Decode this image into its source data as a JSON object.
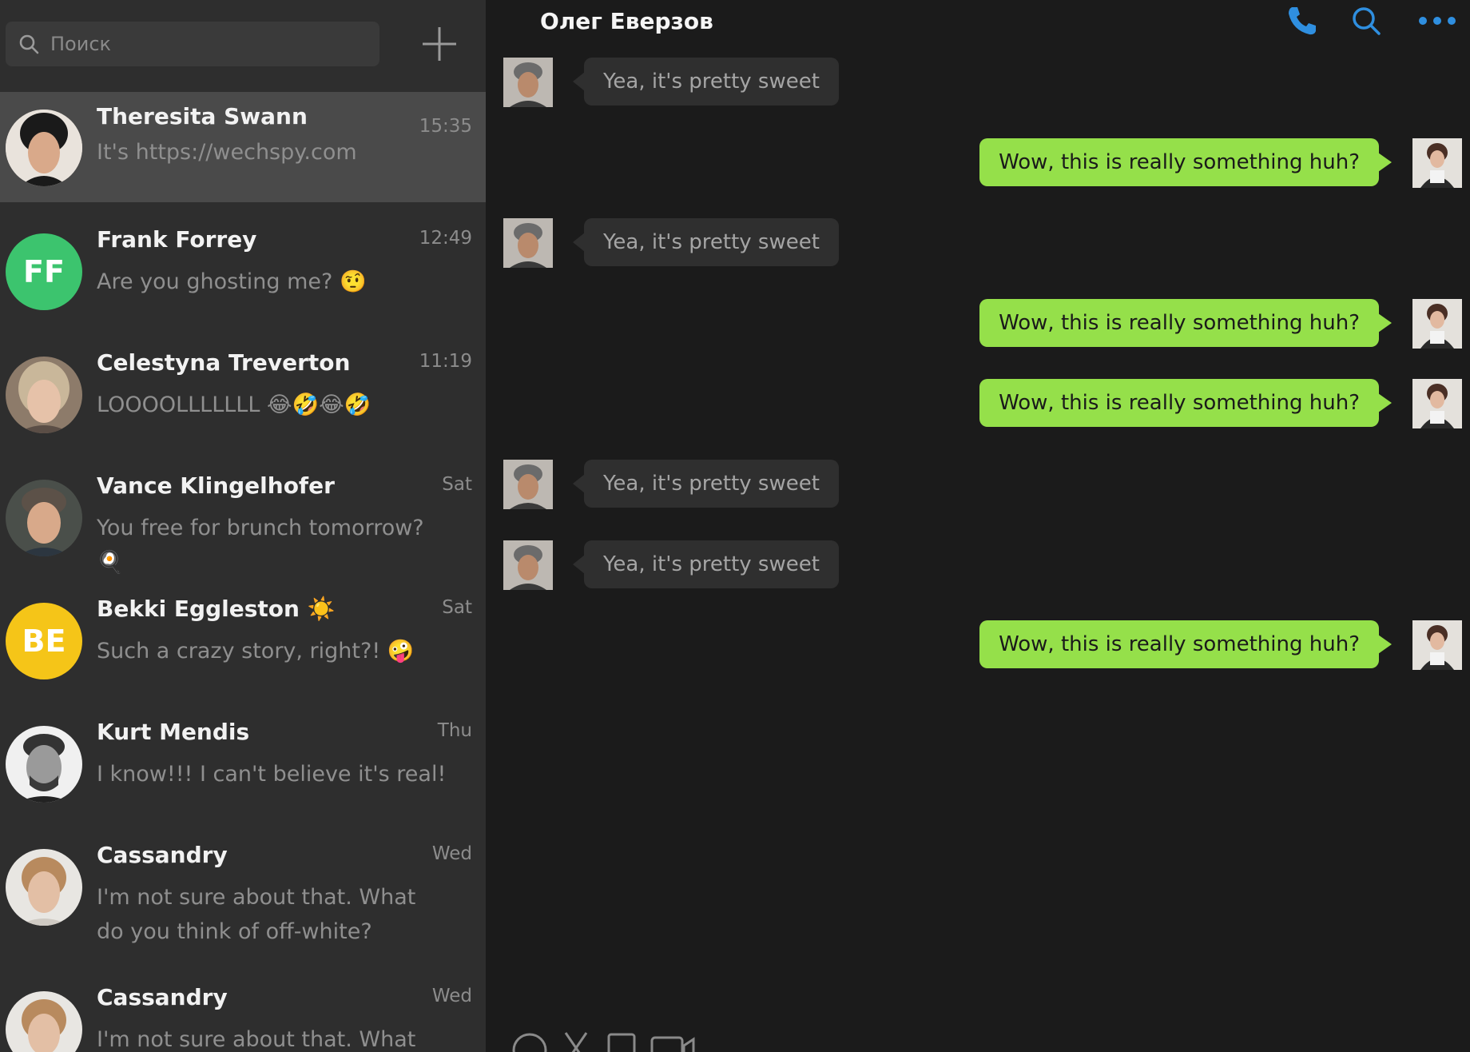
{
  "search": {
    "placeholder": "Поиск"
  },
  "sidebar": {
    "chats": [
      {
        "name": "Theresita Swann",
        "time": "15:35",
        "preview": "It's https://wechspy.com",
        "avatar": "photo"
      },
      {
        "name": "Frank Forrey",
        "time": "12:49",
        "preview": "Are you ghosting me? 🤨",
        "avatar": "initials",
        "initials": "FF",
        "avatar_color": "#3cc46e"
      },
      {
        "name": "Celestyna Treverton",
        "time": "11:19",
        "preview": "LOOOOLLLLLLL 😂🤣😂🤣",
        "avatar": "photo"
      },
      {
        "name": "Vance Klingelhofer",
        "time": "Sat",
        "preview": "You free for brunch tomorrow? 🍳",
        "avatar": "photo"
      },
      {
        "name": "Bekki Eggleston ☀️",
        "time": "Sat",
        "preview": "Such a crazy story, right?! 🤪",
        "avatar": "initials",
        "initials": "BE",
        "avatar_color": "#f5c518"
      },
      {
        "name": "Kurt Mendis",
        "time": "Thu",
        "preview": "I know!!! I can't believe it's real!",
        "avatar": "photo"
      },
      {
        "name": "Cassandry",
        "time": "Wed",
        "preview": "I'm not sure about that. What do you think of off-white?",
        "avatar": "photo"
      },
      {
        "name": "Cassandry",
        "time": "Wed",
        "preview": "I'm not sure about that. What do",
        "avatar": "photo"
      }
    ]
  },
  "chat": {
    "title": "Олег Еверзов",
    "messages": [
      {
        "dir": "in",
        "text": "Yea, it's pretty sweet"
      },
      {
        "dir": "out",
        "text": "Wow, this is really something huh?"
      },
      {
        "dir": "in",
        "text": "Yea, it's pretty sweet"
      },
      {
        "dir": "out",
        "text": "Wow, this is really something huh?"
      },
      {
        "dir": "out",
        "text": "Wow, this is really something huh?"
      },
      {
        "dir": "in",
        "text": "Yea, it's pretty sweet"
      },
      {
        "dir": "in",
        "text": "Yea, it's pretty sweet"
      },
      {
        "dir": "out",
        "text": "Wow, this is really something huh?"
      }
    ]
  },
  "icons": {
    "header": [
      "phone-icon",
      "search-icon",
      "more-icon"
    ],
    "composer": [
      "emoji-icon",
      "scissors-icon",
      "file-icon",
      "video-icon"
    ]
  },
  "colors": {
    "accent_blue": "#2f8fe0",
    "outgoing_bubble": "#95e04a",
    "incoming_bubble": "#2f2f2f",
    "sidebar_bg": "#2e2e2e",
    "active_chat_bg": "#4a4a4a"
  }
}
